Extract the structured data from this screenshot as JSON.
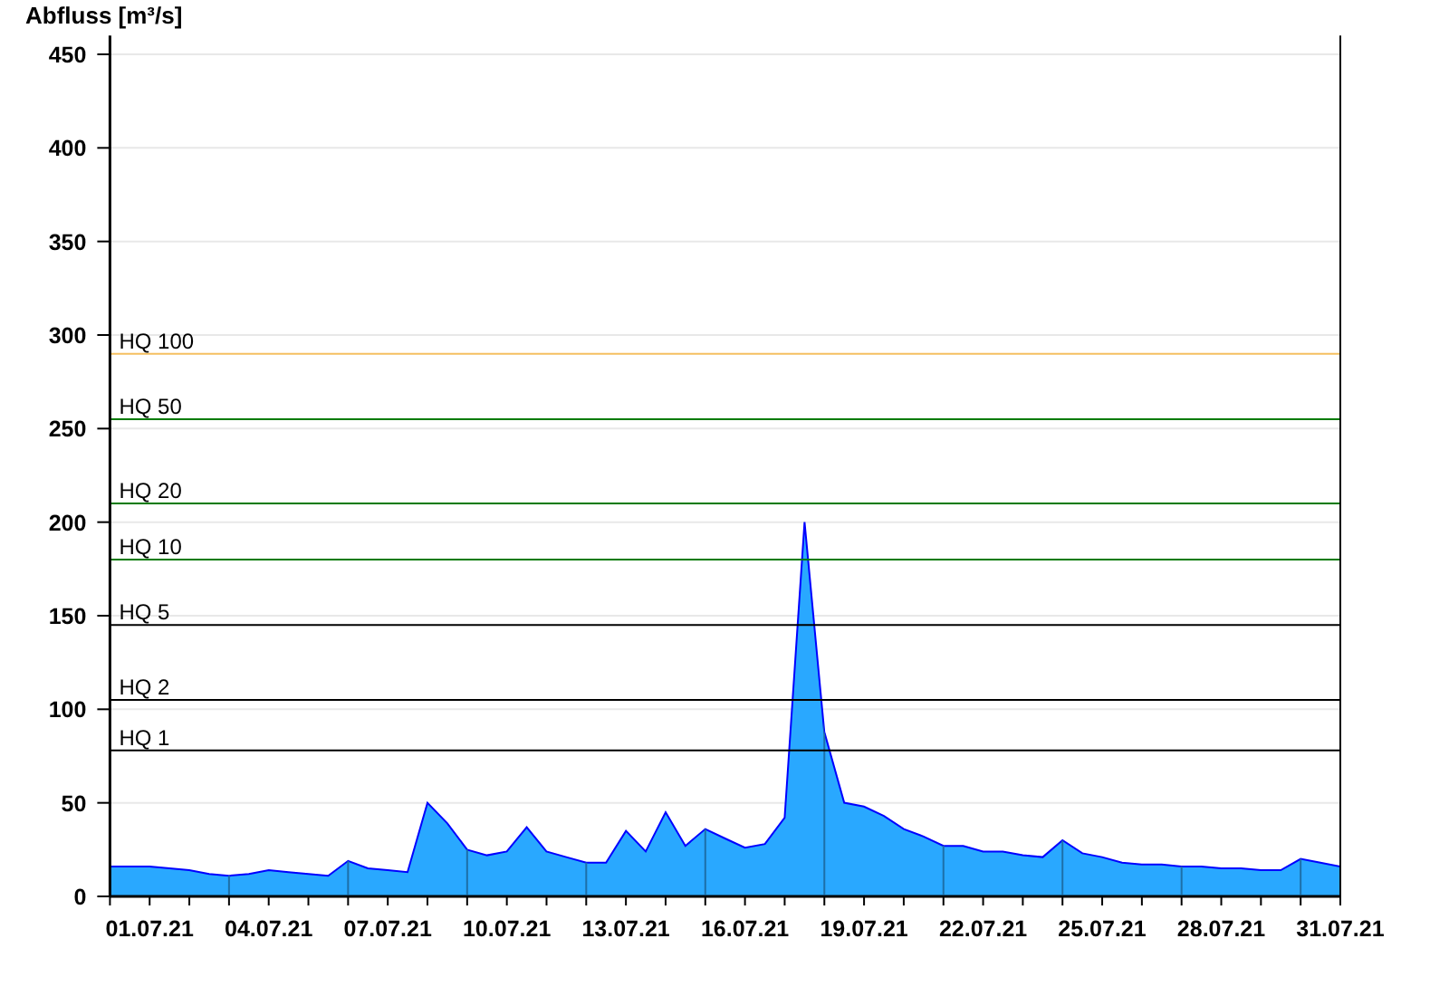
{
  "chart_data": {
    "type": "area",
    "ylabel": "Abfluss [m³/s]",
    "grid": true,
    "ylim": [
      0,
      460
    ],
    "yticks": [
      0,
      50,
      100,
      150,
      200,
      250,
      300,
      350,
      400,
      450
    ],
    "categories": [
      null,
      null,
      "01.07.21",
      null,
      null,
      null,
      null,
      null,
      "04.07.21",
      null,
      null,
      null,
      null,
      null,
      "07.07.21",
      null,
      null,
      null,
      null,
      null,
      "10.07.21",
      null,
      null,
      null,
      null,
      null,
      "13.07.21",
      null,
      null,
      null,
      null,
      null,
      "16.07.21",
      null,
      null,
      null,
      null,
      null,
      "19.07.21",
      null,
      null,
      null,
      null,
      null,
      "22.07.21",
      null,
      null,
      null,
      null,
      null,
      "25.07.21",
      null,
      null,
      null,
      null,
      null,
      "28.07.21",
      null,
      null,
      null,
      null,
      null,
      "31.07.21"
    ],
    "series": [
      {
        "color": "#29a8ff",
        "values": [
          16,
          16,
          16,
          15,
          14,
          12,
          11,
          12,
          14,
          13,
          12,
          11,
          19,
          15,
          14,
          13,
          50,
          39,
          25,
          22,
          24,
          37,
          24,
          21,
          18,
          18,
          35,
          24,
          45,
          27,
          36,
          31,
          26,
          28,
          42,
          200,
          88,
          50,
          48,
          43,
          36,
          32,
          27,
          27,
          24,
          24,
          22,
          21,
          30,
          23,
          21,
          18,
          17,
          17,
          16,
          16,
          15,
          15,
          14,
          14,
          20,
          18,
          16
        ]
      }
    ],
    "ref_lines": [
      {
        "axis": "y",
        "label": "HQ 100",
        "value": 290,
        "color": "#f5c060"
      },
      {
        "axis": "y",
        "label": "HQ 50",
        "value": 255,
        "color": "#007a00"
      },
      {
        "axis": "y",
        "label": "HQ 20",
        "value": 210,
        "color": "#007a00"
      },
      {
        "axis": "y",
        "label": "HQ 10",
        "value": 180,
        "color": "#007a00"
      },
      {
        "axis": "y",
        "label": "HQ 5",
        "value": 145,
        "color": "#000000"
      },
      {
        "axis": "y",
        "label": "HQ 2",
        "value": 105,
        "color": "#000000"
      },
      {
        "axis": "y",
        "label": "HQ 1",
        "value": 78,
        "color": "#000000"
      }
    ]
  }
}
